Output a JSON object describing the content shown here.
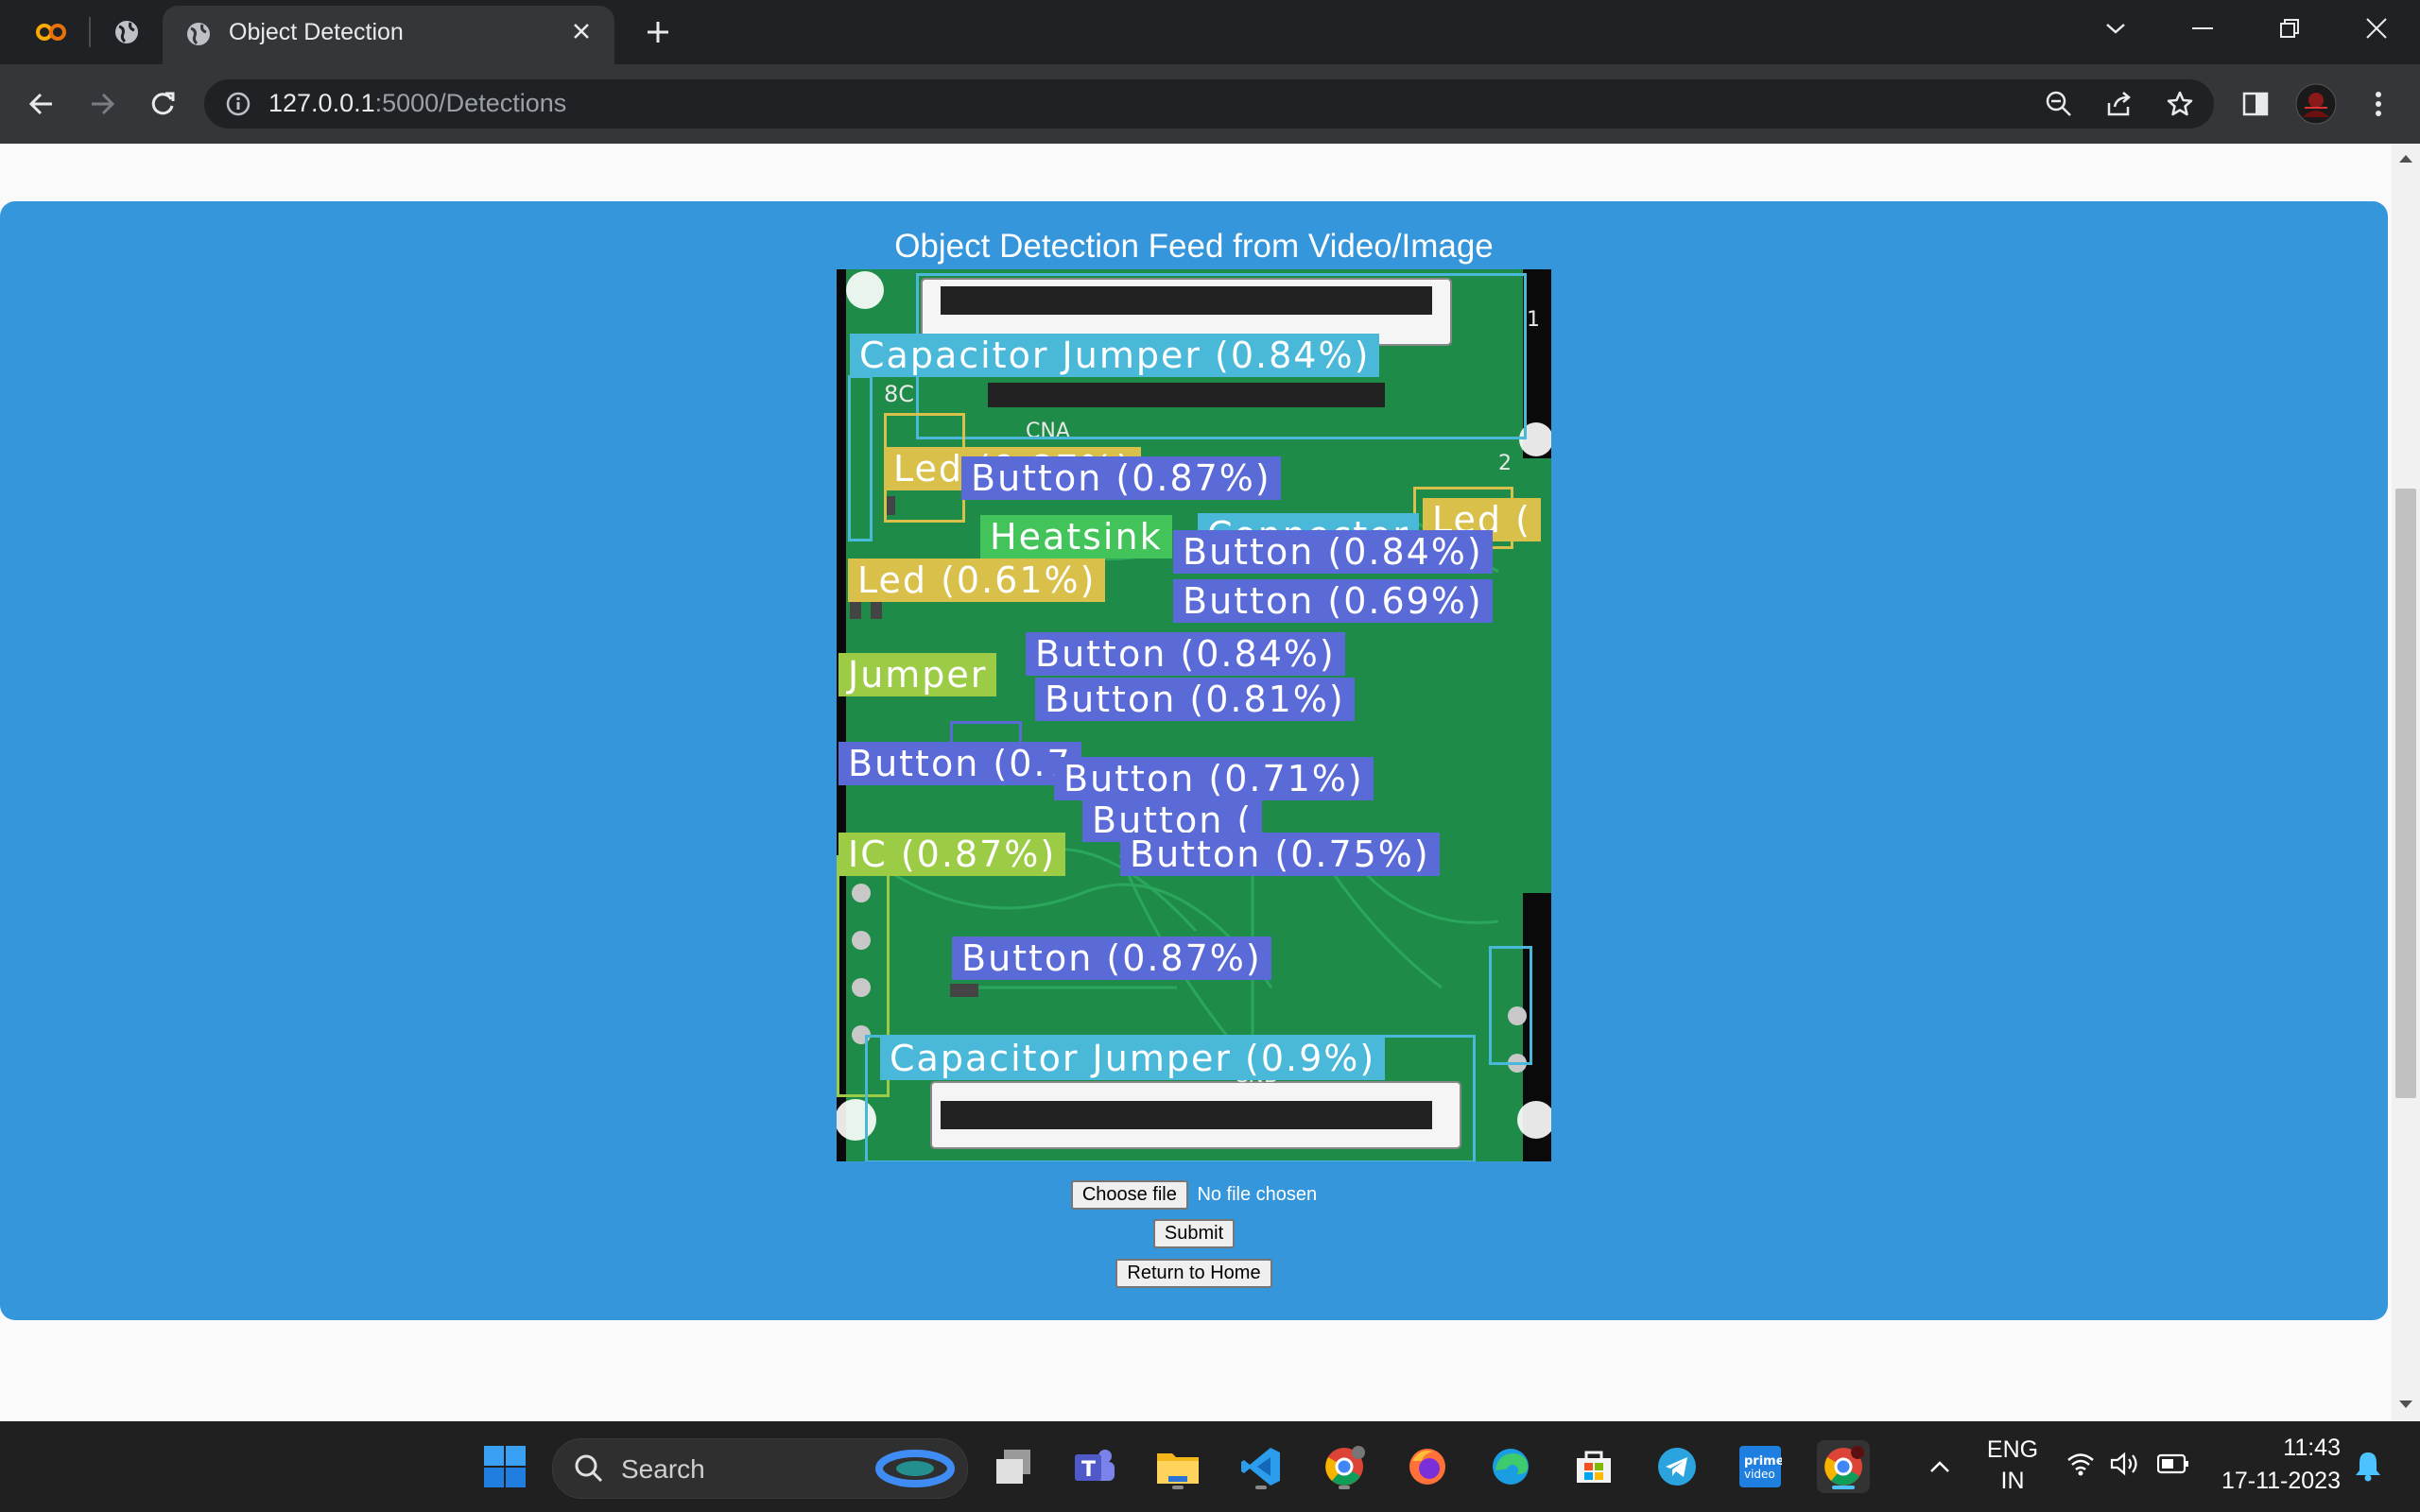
{
  "browser": {
    "tab_title": "Object Detection",
    "url_host": "127.0.0.1",
    "url_path": ":5000/Detections"
  },
  "page": {
    "heading": "Object Detection Feed from Video/Image",
    "choose_file_label": "Choose file",
    "file_status": "No file chosen",
    "submit_label": "Submit",
    "return_label": "Return to Home"
  },
  "detections": [
    {
      "label": "Capacitor Jumper (0.84%)",
      "class": "cap"
    },
    {
      "label": "Led (0.87%)",
      "class": "led"
    },
    {
      "label": "Button (0.87%)",
      "class": "btn"
    },
    {
      "label": "Heatsink",
      "class": "heat"
    },
    {
      "label": "Connector",
      "class": "cap"
    },
    {
      "label": "Led (",
      "class": "led"
    },
    {
      "label": "Button (0.84%)",
      "class": "btn"
    },
    {
      "label": "Led (0.61%)",
      "class": "led"
    },
    {
      "label": "Button (0.69%)",
      "class": "btn"
    },
    {
      "label": "Button (0.84%)",
      "class": "btn"
    },
    {
      "label": "Jumper",
      "class": "ic"
    },
    {
      "label": "Button (0.81%)",
      "class": "btn"
    },
    {
      "label": "Button (0.7",
      "class": "btn"
    },
    {
      "label": "Button (0.71%)",
      "class": "btn"
    },
    {
      "label": "Button (",
      "class": "btn"
    },
    {
      "label": "IC (0.87%)",
      "class": "ic"
    },
    {
      "label": "Button (0.75%)",
      "class": "btn"
    },
    {
      "label": "Button (0.87%)",
      "class": "btn"
    },
    {
      "label": "Capacitor Jumper (0.9%)",
      "class": "cap"
    }
  ],
  "taskbar": {
    "search_placeholder": "Search",
    "lang_line1": "ENG",
    "lang_line2": "IN",
    "time": "11:43",
    "date": "17-11-2023"
  },
  "colors": {
    "panel": "#3596db",
    "chrome_dark": "#202124",
    "chrome_toolbar": "#35363a",
    "det_button": "#5a6ad6",
    "det_led": "#d9c04a",
    "det_capacitor": "#4ab8d8",
    "det_ic": "#9ccc45"
  },
  "icons": [
    "colab-icon",
    "globe-icon",
    "close-icon",
    "plus-icon",
    "chevron-down-icon",
    "minimize-icon",
    "restore-icon",
    "back-icon",
    "forward-icon",
    "reload-icon",
    "info-icon",
    "zoom-out-icon",
    "share-icon",
    "star-icon",
    "sidepanel-icon",
    "avatar",
    "menu-icon",
    "windows-start-icon",
    "search-icon"
  ]
}
